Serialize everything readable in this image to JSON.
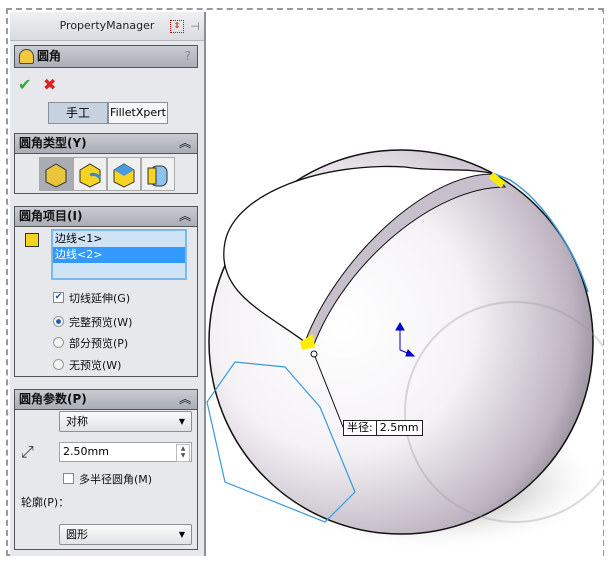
{
  "panel": {
    "title": "PropertyManager",
    "feature_title": "圆角",
    "help": "?"
  },
  "mode": {
    "manual": "手工",
    "filletxpert": "FilletXpert"
  },
  "fillet_type": {
    "header": "圆角类型(Y)"
  },
  "fillet_items": {
    "header": "圆角项目(I)",
    "edges": [
      "边线<1>",
      "边线<2>"
    ],
    "tangent_propagation": "切线延伸(G)",
    "tangent_checked": true,
    "preview_options": [
      {
        "label": "完整预览(W)",
        "selected": true
      },
      {
        "label": "部分预览(P)",
        "selected": false
      },
      {
        "label": "无预览(W)",
        "selected": false
      }
    ]
  },
  "fillet_params": {
    "header": "圆角参数(P)",
    "method": "对称",
    "radius": "2.50mm",
    "multi_radius": "多半径圆角(M)",
    "multi_checked": false,
    "profile_label": "轮廓(P)：",
    "profile": "圆形"
  },
  "viewport": {
    "callout_label": "半径:",
    "callout_value": "2.5mm"
  },
  "colors": {
    "selection": "#3399ff",
    "edge_highlight": "#3a9ad9",
    "fillet_preview": "#ffee00"
  }
}
